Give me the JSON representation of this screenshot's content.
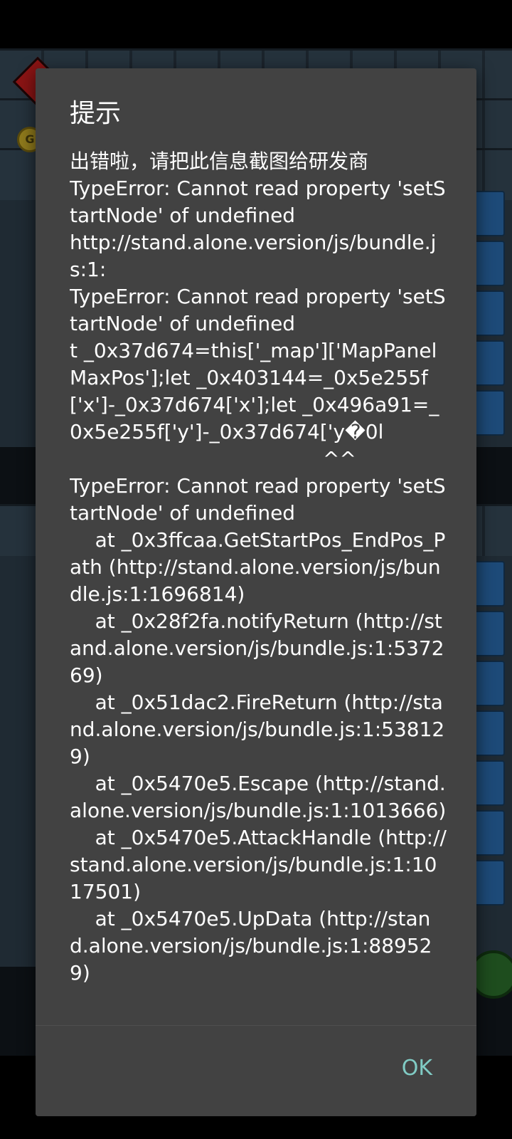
{
  "dialog": {
    "title": "提示",
    "message": "出错啦，请把此信息截图给研发商\nTypeError: Cannot read property 'setStartNode' of undefined\nhttp://stand.alone.version/js/bundle.js:1:\nTypeError: Cannot read property 'setStartNode' of undefined\nt _0x37d674=this['_map']['MapPanelMaxPos'];let _0x403144=_0x5e255f['x']-_0x37d674['x'];let _0x496a91=_0x5e255f['y']-_0x37d674['y�0l\n                                        ^^\nTypeError: Cannot read property 'setStartNode' of undefined\n    at _0x3ffcaa.GetStartPos_EndPos_Path (http://stand.alone.version/js/bundle.js:1:1696814)\n    at _0x28f2fa.notifyReturn (http://stand.alone.version/js/bundle.js:1:537269)\n    at _0x51dac2.FireReturn (http://stand.alone.version/js/bundle.js:1:538129)\n    at _0x5470e5.Escape (http://stand.alone.version/js/bundle.js:1:1013666)\n    at _0x5470e5.AttackHandle (http://stand.alone.version/js/bundle.js:1:1017501)\n    at _0x5470e5.UpData (http://stand.alone.version/js/bundle.js:1:889529)",
    "ok_label": "OK"
  },
  "background": {
    "coin_letter": "G"
  },
  "colors": {
    "dialog_bg": "#424242",
    "text": "#ffffff",
    "accent": "#80cbc4"
  }
}
